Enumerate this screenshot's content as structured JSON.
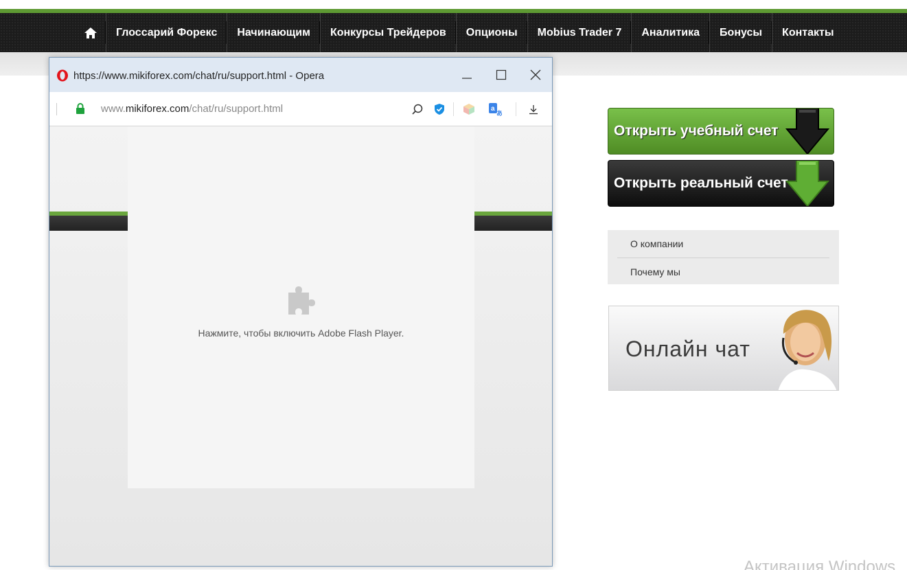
{
  "nav": {
    "items": [
      {
        "label": "Глоссарий Форекс"
      },
      {
        "label": "Начинающим"
      },
      {
        "label": "Конкурсы Трейдеров"
      },
      {
        "label": "Опционы"
      },
      {
        "label": "Mobius Trader 7"
      },
      {
        "label": "Аналитика"
      },
      {
        "label": "Бонусы"
      },
      {
        "label": "Контакты"
      }
    ],
    "home_icon": "home-icon"
  },
  "sidebar": {
    "demo_account_label": "Открыть учебный счет",
    "real_account_label": "Открыть реальный счет",
    "menu": [
      {
        "label": "О компании"
      },
      {
        "label": "Почему мы"
      }
    ],
    "chat_banner_label": "Онлайн чат"
  },
  "popup": {
    "title": "https://www.mikiforex.com/chat/ru/support.html - Opera",
    "url_prefix": "www.",
    "url_domain": "mikiforex.com",
    "url_path": "/chat/ru/support.html",
    "plugin_message": "Нажмите, чтобы включить Adobe Flash Player.",
    "icons": [
      "opera-icon",
      "lock-icon",
      "search-icon",
      "shield-icon",
      "cube-icon",
      "translate-icon",
      "download-icon",
      "puzzle-icon"
    ]
  },
  "os": {
    "activation_watermark": "Активация Windows"
  },
  "colors": {
    "brand_green": "#5e9a33",
    "nav_dark": "#1c1c1c",
    "titlebar": "#dfe8f3"
  }
}
